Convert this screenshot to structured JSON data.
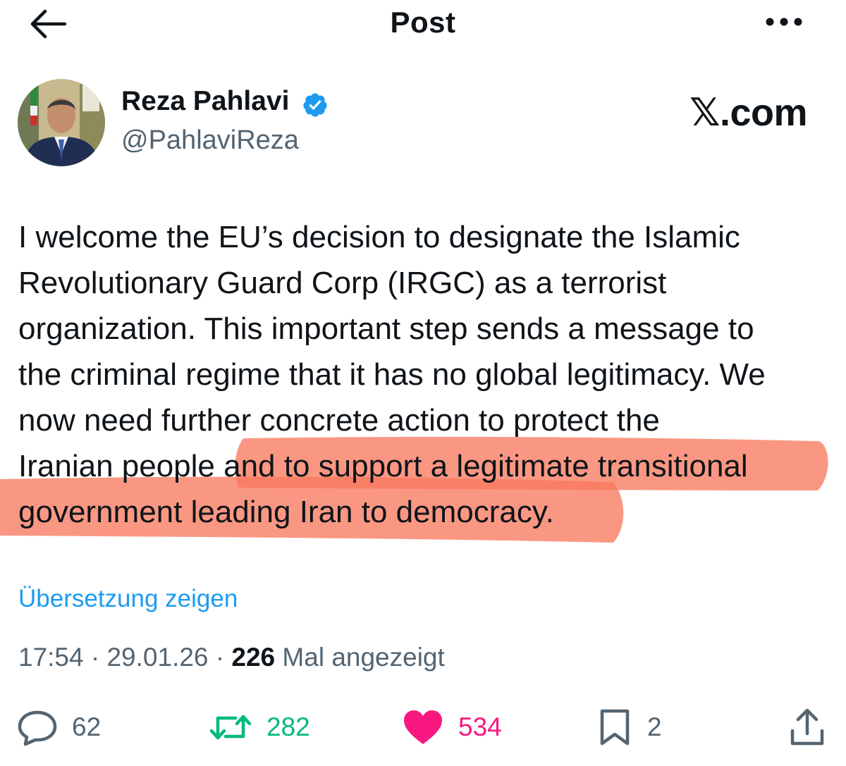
{
  "header": {
    "title": "Post",
    "back_icon": "arrow-left-icon",
    "more_icon": "more-horizontal-icon"
  },
  "author": {
    "name": "Reza Pahlavi",
    "handle": "@PahlaviReza",
    "verified": true,
    "badge_color": "#1d9bf0"
  },
  "watermark": "𝕏.com",
  "tweet": {
    "text": "I welcome the EU’s decision to designate the Islamic\nRevolutionary Guard Corp (IRGC) as a terrorist\norganization. This important step sends a message to\nthe criminal regime that it has no global legitimacy. We\nnow need further concrete action to protect the\nIranian people and to support a legitimate transitional\ngovernment leading Iran to democracy.",
    "highlight_color": "#f87a5f"
  },
  "translate_label": "Übersetzung zeigen",
  "meta": {
    "time": "17:54",
    "date": "29.01.26",
    "views": "226",
    "views_label": "Mal angezeigt"
  },
  "actions": {
    "replies": "62",
    "reposts": "282",
    "likes": "534",
    "bookmarks": "2"
  },
  "colors": {
    "text": "#0f1419",
    "secondary": "#536471",
    "link": "#1d9bf0",
    "repost": "#00ba7c",
    "like": "#f91880"
  }
}
